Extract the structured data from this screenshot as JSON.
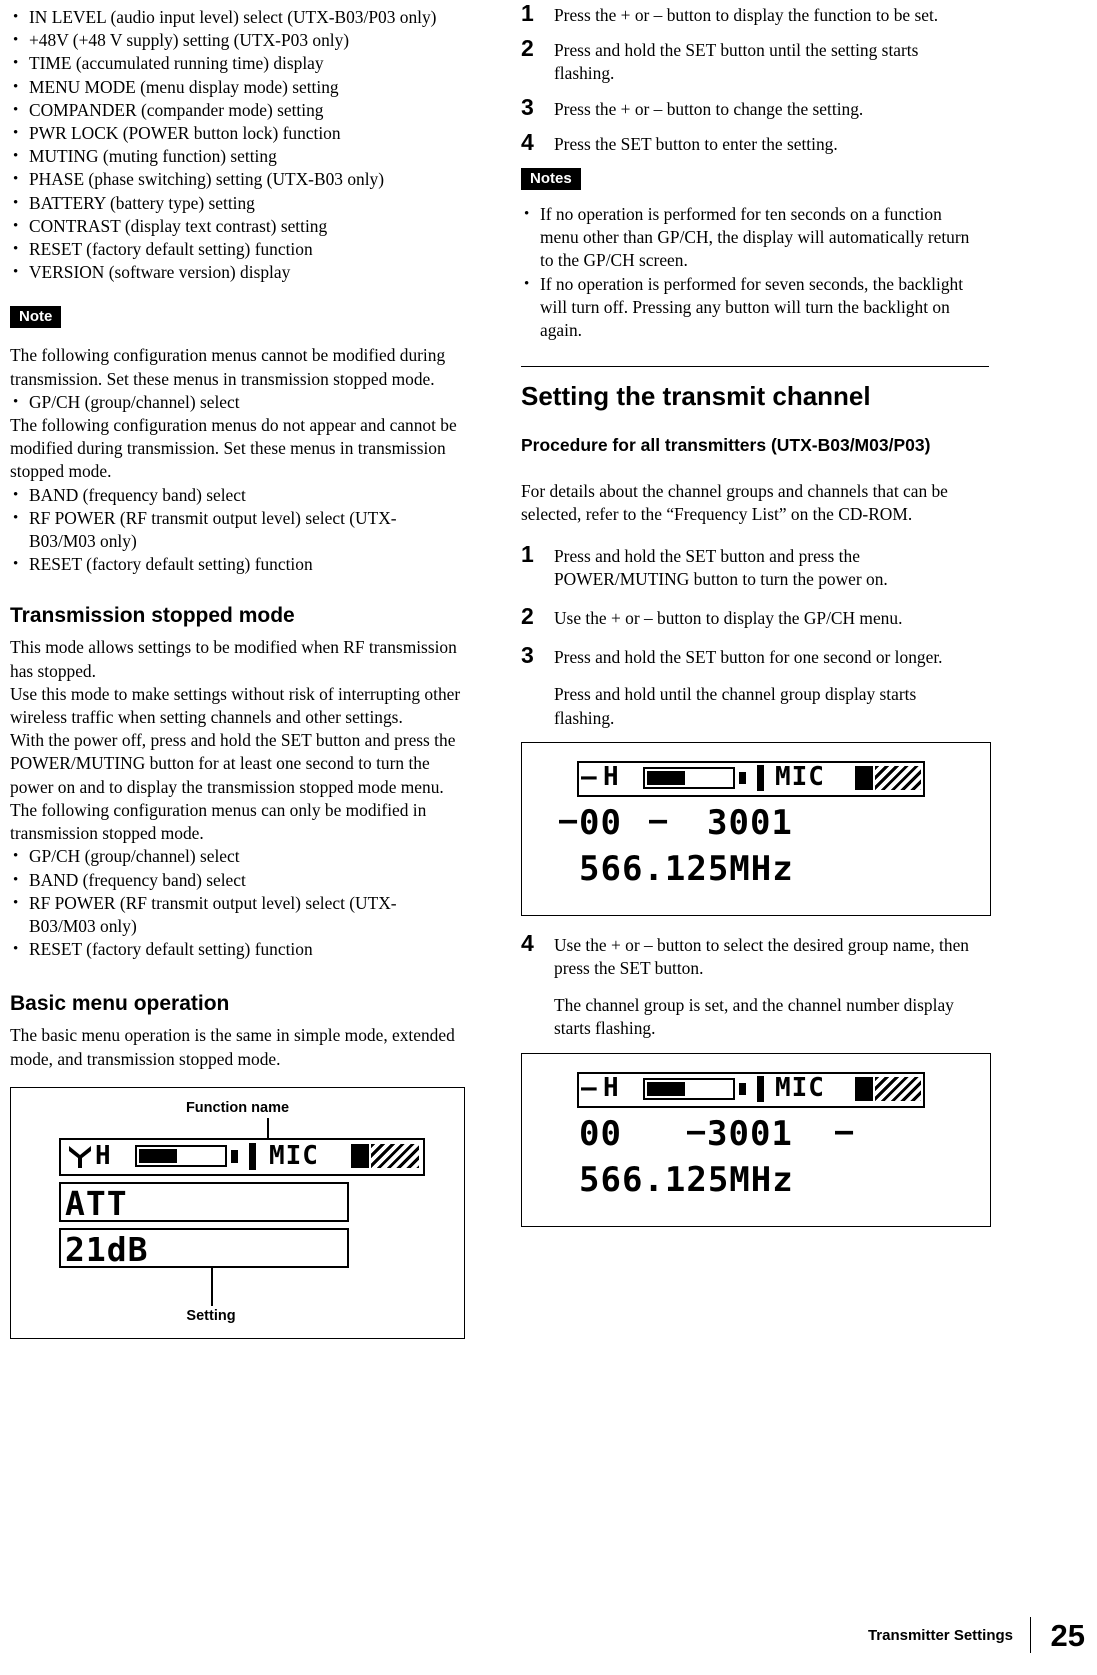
{
  "left_column": {
    "feature_list": [
      "IN LEVEL (audio input level) select (UTX-B03/P03 only)",
      "+48V (+48 V supply) setting (UTX-P03 only)",
      "TIME (accumulated running time) display",
      "MENU MODE (menu display mode) setting",
      "COMPANDER (compander mode) setting",
      "PWR LOCK (POWER button lock) function",
      "MUTING (muting function) setting",
      "PHASE (phase switching) setting (UTX-B03 only)",
      "BATTERY (battery type) setting",
      "CONTRAST (display text contrast) setting",
      "RESET (factory default setting) function",
      "VERSION (software version) display"
    ],
    "note_tag": "Note",
    "note_para1": "The following configuration menus cannot be modified during transmission. Set these menus in transmission stopped mode.",
    "note_bullets1": [
      "GP/CH (group/channel) select"
    ],
    "note_para2": "The following configuration menus do not appear and cannot be modified during transmission. Set these menus in transmission stopped mode.",
    "note_bullets2": [
      "BAND (frequency band) select",
      "RF POWER (RF transmit output level) select (UTX-B03/M03 only)",
      "RESET (factory default setting) function"
    ],
    "heading_transmission_stopped": "Transmission stopped mode",
    "ts_para": "This mode allows settings to be modified when RF transmission has stopped.\nUse this mode to make settings without risk of interrupting other wireless traffic when setting channels and other settings.\nWith the power off, press and hold the SET button and press the POWER/MUTING button for at least one second to turn the power on and to display the transmission stopped mode menu.\nThe following configuration menus can only be modified in transmission stopped mode.",
    "ts_bullets": [
      "GP/CH (group/channel) select",
      "BAND (frequency band) select",
      "RF POWER (RF transmit output level) select (UTX-B03/M03 only)",
      "RESET (factory default setting) function"
    ],
    "heading_basic_menu": "Basic menu operation",
    "basic_para": "The basic menu operation is the same in simple mode, extended mode, and transmission stopped mode.",
    "figure": {
      "callout_top": "Function name",
      "callout_bottom": "Setting",
      "lcd_line1": "ATT",
      "lcd_line2": "21dB",
      "status_mic": "MIC"
    }
  },
  "right_column": {
    "steps_top": [
      {
        "num": "1",
        "text": "Press the + or – button to display the function to be set."
      },
      {
        "num": "2",
        "text": "Press and hold the SET button until the setting starts flashing."
      },
      {
        "num": "3",
        "text": "Press the + or – button to change the setting."
      },
      {
        "num": "4",
        "text": "Press the SET button to enter the setting."
      }
    ],
    "notes_tag": "Notes",
    "notes_bullets": [
      "If no operation is performed for ten seconds on a function menu other than GP/CH, the display will automatically return to the GP/CH screen.",
      "If no operation is performed for seven seconds, the backlight will turn off. Pressing any button will turn the backlight on again."
    ],
    "heading_setting_channel": "Setting the transmit channel",
    "sub_procedure": "Procedure for all transmitters (UTX-B03/M03/P03)",
    "detail_para": "For details about the channel groups and channels that can be selected, refer to the “Frequency List” on the CD-ROM.",
    "steps_bottom": [
      {
        "num": "1",
        "text": "Press and hold the SET button and press the POWER/MUTING button to turn the power on."
      },
      {
        "num": "2",
        "text": "Use the + or – button to display the GP/CH menu."
      },
      {
        "num": "3",
        "text": "Press and hold the SET button for one second or longer.",
        "sub": "Press and hold until the channel group display starts flashing."
      },
      {
        "num": "4",
        "text": "Use the + or – button to select the desired group name, then press the SET button.",
        "sub": "The channel group is set, and the channel number display starts flashing."
      }
    ],
    "figure1": {
      "group": "00",
      "channel": "3001",
      "freq": "566.125MHz",
      "status_mic": "MIC"
    },
    "figure2": {
      "group": "00",
      "channel": "3001",
      "freq": "566.125MHz",
      "status_mic": "MIC"
    }
  },
  "footer": {
    "section": "Transmitter Settings",
    "page": "25"
  }
}
